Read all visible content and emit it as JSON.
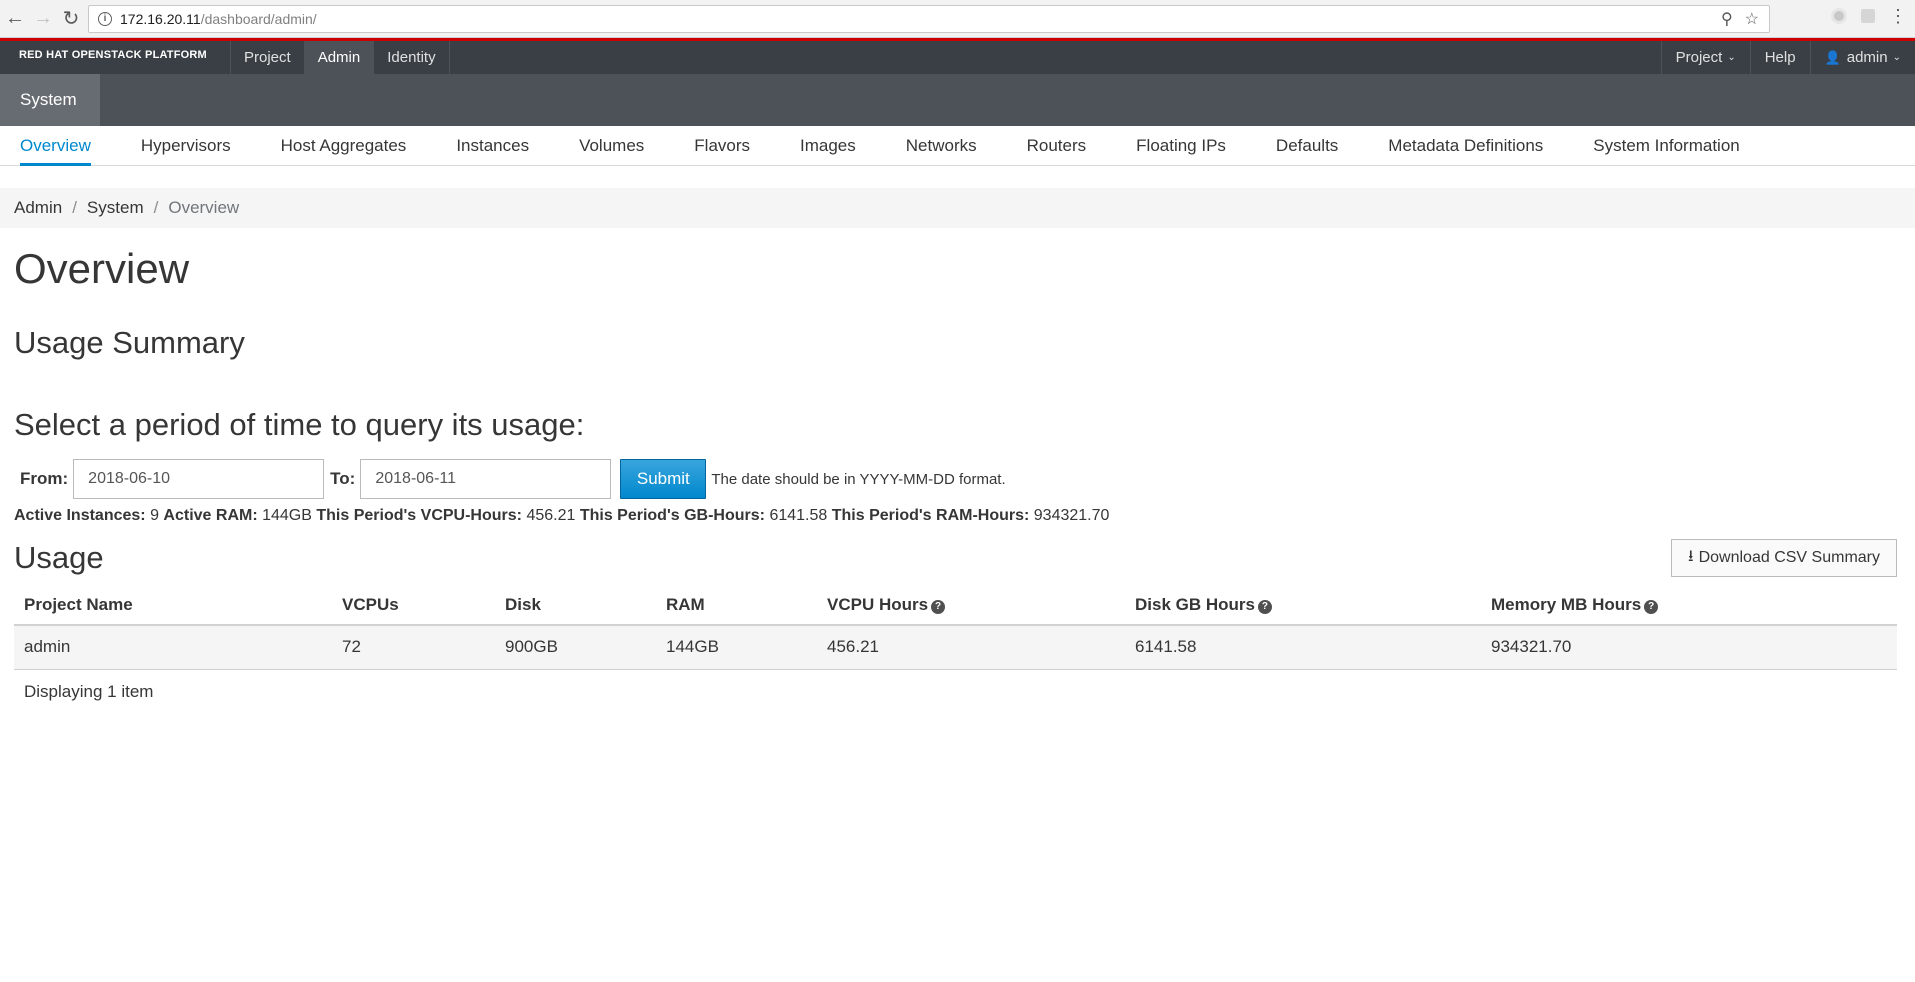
{
  "browser": {
    "url_host": "172.16.20.11",
    "url_path": "/dashboard/admin/"
  },
  "masthead": {
    "brand": "RED HAT OPENSTACK PLATFORM",
    "nav": [
      "Project",
      "Admin",
      "Identity"
    ],
    "active_nav": "Admin",
    "right": {
      "project": "Project",
      "help": "Help",
      "user": "admin"
    }
  },
  "secondary": {
    "tab": "System"
  },
  "tertiary": {
    "items": [
      "Overview",
      "Hypervisors",
      "Host Aggregates",
      "Instances",
      "Volumes",
      "Flavors",
      "Images",
      "Networks",
      "Routers",
      "Floating IPs",
      "Defaults",
      "Metadata Definitions",
      "System Information"
    ],
    "active": "Overview"
  },
  "breadcrumb": {
    "items": [
      "Admin",
      "System"
    ],
    "current": "Overview"
  },
  "page": {
    "title": "Overview",
    "usage_summary": "Usage Summary",
    "period_title": "Select a period of time to query its usage:"
  },
  "form": {
    "from_label": "From:",
    "from_value": "2018-06-10",
    "to_label": "To:",
    "to_value": "2018-06-11",
    "submit_label": "Submit",
    "hint": "The date should be in YYYY-MM-DD format."
  },
  "stats": {
    "active_instances_label": "Active Instances:",
    "active_instances": "9",
    "active_ram_label": "Active RAM:",
    "active_ram": "144GB",
    "vcpu_hours_label": "This Period's VCPU-Hours:",
    "vcpu_hours": "456.21",
    "gb_hours_label": "This Period's GB-Hours:",
    "gb_hours": "6141.58",
    "ram_hours_label": "This Period's RAM-Hours:",
    "ram_hours": "934321.70"
  },
  "usage": {
    "title": "Usage",
    "csv_button": "Download CSV Summary",
    "columns": [
      "Project Name",
      "VCPUs",
      "Disk",
      "RAM",
      "VCPU Hours",
      "Disk GB Hours",
      "Memory MB Hours"
    ],
    "rows": [
      [
        "admin",
        "72",
        "900GB",
        "144GB",
        "456.21",
        "6141.58",
        "934321.70"
      ]
    ],
    "footer": "Displaying 1 item"
  },
  "colors": {
    "accent": "#0088ce",
    "masthead": "#393f44",
    "brand_red": "#cc0000"
  }
}
